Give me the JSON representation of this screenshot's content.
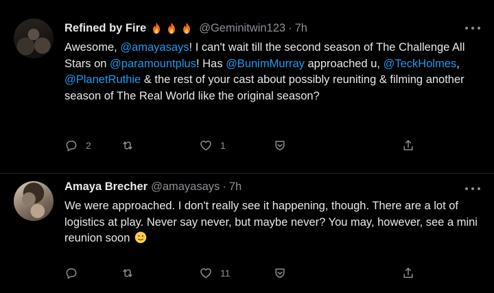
{
  "tweets": [
    {
      "author": {
        "name": "Refined by Fire",
        "handle": "@Geminitwin123",
        "time": "7h",
        "emoji_badges": [
          "fire-icon",
          "fire-icon",
          "fire-icon"
        ]
      },
      "body": {
        "t1": "Awesome, ",
        "m1": "@amayasays",
        "t2": "! I can't wait till the second season of The Challenge All Stars on ",
        "m2": "@paramountplus",
        "t3": "!  Has ",
        "m3": "@BunimMurray",
        "t4": " approached u, ",
        "m4": "@TeckHolmes",
        "t5": ", ",
        "m5": "@PlanetRuthie",
        "t6": " & the rest of your cast about possibly reuniting & filming another season of The Real World like the original season?"
      },
      "actions": {
        "reply_count": "2",
        "retweet_count": "",
        "like_count": "1"
      }
    },
    {
      "author": {
        "name": "Amaya Brecher",
        "handle": "@amayasays",
        "time": "7h"
      },
      "body": {
        "t1": "We were approached. I don't really see it happening, though. There are a lot of logistics at play. Never say never, but maybe never? You may, however, see a mini reunion soon ",
        "emoji": "winking-face-emoji"
      },
      "actions": {
        "reply_count": "",
        "retweet_count": "",
        "like_count": "11"
      }
    }
  ],
  "separator": "·",
  "colors": {
    "background": "#000000",
    "text": "#e7e9ea",
    "muted": "#8b9096",
    "mention": "#1d9bf0",
    "divider": "#2a2d31"
  }
}
